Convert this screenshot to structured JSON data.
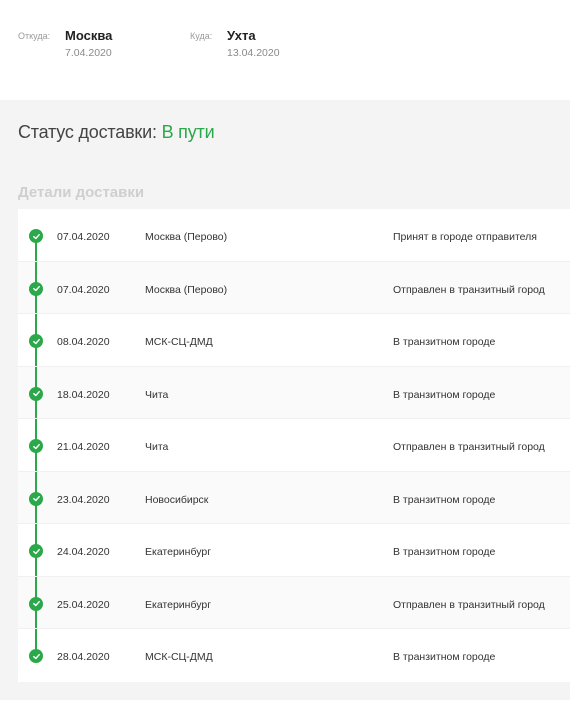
{
  "route": {
    "from_label": "Откуда:",
    "from_city": "Москва",
    "from_date": "7.04.2020",
    "to_label": "Куда:",
    "to_city": "Ухта",
    "to_date": "13.04.2020"
  },
  "status": {
    "label": "Статус доставки:",
    "value": "В пути"
  },
  "details_title": "Детали доставки",
  "events": [
    {
      "date": "07.04.2020",
      "place": "Москва (Перово)",
      "status": "Принят в городе отправителя"
    },
    {
      "date": "07.04.2020",
      "place": "Москва (Перово)",
      "status": "Отправлен в транзитный город"
    },
    {
      "date": "08.04.2020",
      "place": "МСК-СЦ-ДМД",
      "status": "В транзитном городе"
    },
    {
      "date": "18.04.2020",
      "place": "Чита",
      "status": "В транзитном городе"
    },
    {
      "date": "21.04.2020",
      "place": "Чита",
      "status": "Отправлен в транзитный город"
    },
    {
      "date": "23.04.2020",
      "place": "Новосибирск",
      "status": "В транзитном городе"
    },
    {
      "date": "24.04.2020",
      "place": "Екатеринбург",
      "status": "В транзитном городе"
    },
    {
      "date": "25.04.2020",
      "place": "Екатеринбург",
      "status": "Отправлен в транзитный город"
    },
    {
      "date": "28.04.2020",
      "place": "МСК-СЦ-ДМД",
      "status": "В транзитном городе"
    }
  ],
  "icons": {
    "event_marker": "check-circle-icon"
  },
  "colors": {
    "accent": "#2aa84a"
  }
}
